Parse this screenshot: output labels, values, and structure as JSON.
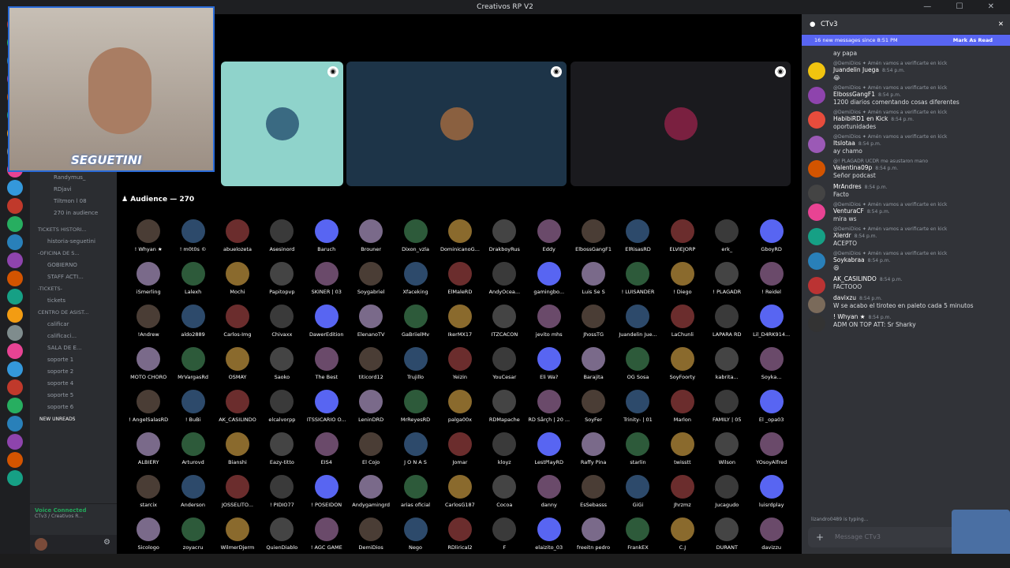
{
  "window": {
    "title": "Creativos RP V2"
  },
  "overlay": {
    "streamer_tag": "SEGUETINI"
  },
  "channels": {
    "voice_members": [
      "Randymus_",
      "RDjavi",
      "Tiltmon l 08"
    ],
    "audience_count_text": "270 in audience",
    "items": [
      {
        "type": "cat",
        "label": "TICKETS HISTORI..."
      },
      {
        "type": "ch",
        "label": "historia-seguetini"
      },
      {
        "type": "cat",
        "label": "-OFICINA DE S..."
      },
      {
        "type": "ch",
        "label": "GOBIERNO"
      },
      {
        "type": "ch",
        "label": "STAFF ACTI..."
      },
      {
        "type": "cat",
        "label": "-TICKETS-"
      },
      {
        "type": "ch",
        "label": "tickets"
      },
      {
        "type": "cat",
        "label": "CENTRO DE ASIST..."
      },
      {
        "type": "ch",
        "label": "calificar"
      },
      {
        "type": "ch",
        "label": "calificaci..."
      },
      {
        "type": "ch",
        "label": "SALA DE E..."
      },
      {
        "type": "ch",
        "label": "soporte 1"
      },
      {
        "type": "ch",
        "label": "soporte 2"
      },
      {
        "type": "ch",
        "label": "soporte 4"
      },
      {
        "type": "ch",
        "label": "soporte 5"
      },
      {
        "type": "ch",
        "label": "soporte 6"
      }
    ],
    "new_unreads": "NEW UNREADS",
    "voice_connected": "Voice Connected",
    "voice_sub": "CTv3 / Creativos R..."
  },
  "stage": {
    "audience_header": "Audience — 270",
    "audience": [
      "! Whyan ★",
      "! m0t0s ©",
      "abuelozeta",
      "Asesinord",
      "Baruch",
      "Brouner",
      "Dixon_vzla",
      "DominicanoG...",
      "DrakboyRus",
      "Eddy",
      "ElbossGangF1",
      "ElRisasRD",
      "ELVIEJORP",
      "erk_",
      "GboyRD",
      "iSmerling",
      "Lalexh",
      "Mochi",
      "Papitopvp",
      "SKINER | 03",
      "Soygabriel",
      "Xfaceking",
      "ElMaleRD",
      "AndyOcea...",
      "gamingbo...",
      "Luis Se S",
      "! LUISANDER",
      "! Diego",
      "! PLAGADR",
      "! Reidel",
      "!Andrew",
      "aldo2889",
      "Carlos-Img",
      "Chivaxx",
      "DawerEdition",
      "ElenanoTV",
      "GaBriielMv",
      "IkerMX17",
      "ITZCACON",
      "jevito mhs",
      "JhossTG",
      "Juandelin Jue...",
      "LaChunli",
      "LAPARA RD",
      "Lil_D4RK914...",
      "MOTO CHORO",
      "MrVargasRd",
      "OSMAY",
      "Saoko",
      "The Best",
      "titicord12",
      "Trujillo",
      "Yeizin",
      "YouCesar",
      "Eli Wa?",
      "Barajita",
      "OG Sosa",
      "SoyFoorty",
      "kabrita...",
      "Soyka...",
      "! AngelSalasRD",
      "! BuBi",
      "AK_CASILINDO",
      "elcalvorpp",
      "ITSSICARIO O...",
      "LeninDRD",
      "MrReyesRD",
      "palga00x",
      "RDMapache",
      "RD Sårçh | 20 ...",
      "SoyFer",
      "Trinity- | 01",
      "Marlon",
      "FAMILY | 05",
      "El _opa03",
      "ALBIERY",
      "Arturovd",
      "Bianshi",
      "Eazy-titto",
      "EIS4",
      "El Cojo",
      "J O N A S",
      "Jomar",
      "kloyz",
      "LestPlayRD",
      "Raffy Pina",
      "starlin",
      "twisstt",
      "Wilson",
      "YOsoyAlfred",
      "starcix",
      "Anderson",
      "JOSSELITO...",
      "! PIDIO77",
      "! POSEIDON",
      "Andygamingrd",
      "arias oficial",
      "CarlosG187",
      "Cocoa",
      "danny",
      "EsSebasss",
      "GiGi",
      "Jhrzmz",
      "Jucagudo",
      "luisrdplay",
      "Sicologo",
      "zoyacru",
      "WilmerDjerm",
      "QuienDiablo",
      "! AGC GAME",
      "DemiDios",
      "Nego",
      "RDlirical2",
      "F",
      "elaizito_03",
      "freeitn pedro",
      "FrankEX",
      "C.J",
      "DURANT",
      "davizzu"
    ]
  },
  "chat": {
    "channel": "CTv3",
    "banner": "16 new messages since 8:51 PM",
    "mark_read": "Mark As Read",
    "messages": [
      {
        "reply": "",
        "author": "",
        "time": "",
        "text": "ay papa"
      },
      {
        "reply": "@DemiDios ✦ Amén vamos a verificarte en kick",
        "author": "Juandelin Juega",
        "time": "8:54 p.m.",
        "text": "😂"
      },
      {
        "reply": "@DemiDios ✦ Amén vamos a verificarte en kick",
        "author": "ElbossGangF1",
        "time": "8:54 p.m.",
        "text": "1200 diarios comentando cosas diferentes"
      },
      {
        "reply": "@DemiDios ✦ Amén vamos a verificarte en kick",
        "author": "HabibiRD1 en Kick",
        "time": "8:54 p.m.",
        "text": "oportunidades"
      },
      {
        "reply": "@DemiDios ✦ Amén vamos a verificarte en kick",
        "author": "Itslotaa",
        "time": "8:54 p.m.",
        "text": "ay chamo"
      },
      {
        "reply": "@! PLAGADR UCDR me asustaron mano",
        "author": "Valentina09p",
        "time": "8:54 p.m.",
        "text": "Señor podcast"
      },
      {
        "reply": "",
        "author": "MrAndres",
        "time": "8:54 p.m.",
        "text": "Facto"
      },
      {
        "reply": "@DemiDios ✦ Amén vamos a verificarte en kick",
        "author": "VenturaCF",
        "time": "8:54 p.m.",
        "text": "mira ws"
      },
      {
        "reply": "@DemiDios ✦ Amén vamos a verificarte en kick",
        "author": "Xlerdr",
        "time": "8:54 p.m.",
        "text": "ACEPTO"
      },
      {
        "reply": "@DemiDios ✦ Amén vamos a verificarte en kick",
        "author": "Soykabraa",
        "time": "8:54 p.m.",
        "text": "😆"
      },
      {
        "reply": "",
        "author": "AK_CASILINDO",
        "time": "8:54 p.m.",
        "text": "FACTOOO"
      },
      {
        "reply": "",
        "author": "davixzu",
        "time": "8:54 p.m.",
        "text": "W se acabo el tiroteo en paleto cada 5 minutos"
      },
      {
        "reply": "",
        "author": "! Whyan ★",
        "time": "8:54 p.m.",
        "text": "ADM ON TOP ATT: Sr Sharky"
      }
    ],
    "typing": "lizandro0489 is typing...",
    "placeholder": "Message CTv3"
  }
}
